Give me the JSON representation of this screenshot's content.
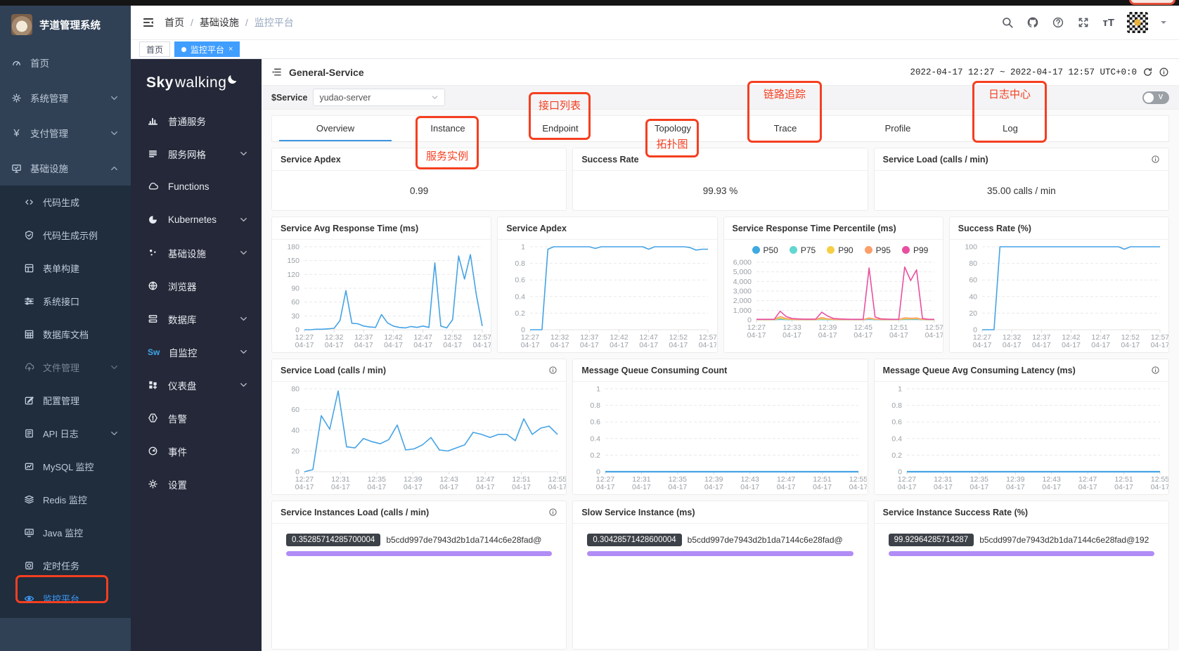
{
  "sidebar": {
    "brand": "芋道管理系统",
    "top": [
      {
        "label": "首页"
      },
      {
        "label": "系统管理",
        "chevron": "down"
      },
      {
        "label": "支付管理",
        "chevron": "down"
      },
      {
        "label": "基础设施",
        "chevron": "up"
      }
    ],
    "sub": [
      {
        "label": "代码生成"
      },
      {
        "label": "代码生成示例"
      },
      {
        "label": "表单构建"
      },
      {
        "label": "系统接口"
      },
      {
        "label": "数据库文档"
      },
      {
        "label": "文件管理",
        "chevron": "down"
      },
      {
        "label": "配置管理"
      },
      {
        "label": "API 日志",
        "chevron": "down"
      },
      {
        "label": "MySQL 监控"
      },
      {
        "label": "Redis 监控"
      },
      {
        "label": "Java 监控"
      },
      {
        "label": "定时任务"
      },
      {
        "label": "监控平台",
        "active": true
      }
    ]
  },
  "topbar": {
    "breadcrumb": [
      "首页",
      "基础设施",
      "监控平台"
    ],
    "icons": [
      "search",
      "github",
      "help",
      "fullscreen",
      "font-size",
      "avatar",
      "caret"
    ]
  },
  "tags": {
    "items": [
      {
        "label": "首页",
        "active": false
      },
      {
        "label": "监控平台",
        "active": true,
        "close": "×"
      }
    ]
  },
  "sw_sidebar": {
    "logo_sky": "Sky",
    "logo_walking": "walking",
    "items": [
      {
        "label": "普通服务"
      },
      {
        "label": "服务网格",
        "chevron": true
      },
      {
        "label": "Functions"
      },
      {
        "label": "Kubernetes",
        "chevron": true
      },
      {
        "label": "基础设施",
        "chevron": true
      },
      {
        "label": "浏览器"
      },
      {
        "label": "数据库",
        "chevron": true
      },
      {
        "label": "自监控",
        "chevron": true,
        "icon_text": "Sw"
      },
      {
        "label": "仪表盘",
        "chevron": true
      },
      {
        "label": "告警"
      },
      {
        "label": "事件"
      },
      {
        "label": "设置"
      }
    ]
  },
  "page_header": {
    "title": "General-Service",
    "time_range": "2022-04-17 12:27 ~ 2022-04-17 12:57 UTC+0:0"
  },
  "service_bar": {
    "label": "$Service",
    "value": "yudao-server",
    "toggle_label": "V"
  },
  "tabs": {
    "items": [
      {
        "label": "Overview",
        "active": true
      },
      {
        "label": "Instance"
      },
      {
        "label": "Endpoint"
      },
      {
        "label": "Topology"
      },
      {
        "label": "Trace"
      },
      {
        "label": "Profile"
      },
      {
        "label": "Log"
      }
    ]
  },
  "annotations": {
    "color": "#f53f20",
    "instance_label": "服务实例",
    "endpoint_label": "接口列表",
    "topology_label": "拓扑图",
    "trace_label": "链路追踪",
    "log_label": "日志中心"
  },
  "metric_cards": [
    {
      "title": "Service Apdex",
      "value": "0.99"
    },
    {
      "title": "Success Rate",
      "value": "99.93 %"
    },
    {
      "title": "Service Load (calls / min)",
      "value": "35.00 calls / min",
      "info": true
    }
  ],
  "chart_data": [
    {
      "id": "avg-rt",
      "type": "line",
      "title": "Service Avg Response Time (ms)",
      "ylim": [
        0,
        180
      ],
      "yticks": [
        0,
        30,
        60,
        90,
        120,
        150,
        180
      ],
      "xlabels": [
        "12:27",
        "12:32",
        "12:37",
        "12:42",
        "12:47",
        "12:52",
        "12:57"
      ],
      "xsub": "04-17",
      "series": [
        {
          "name": "avg-response-time",
          "color": "#45a3e5",
          "values": [
            0,
            0,
            1,
            1,
            2,
            3,
            20,
            85,
            14,
            13,
            8,
            6,
            5,
            33,
            15,
            8,
            5,
            4,
            7,
            5,
            8,
            5,
            145,
            8,
            4,
            22,
            160,
            110,
            163,
            75,
            8
          ]
        }
      ]
    },
    {
      "id": "apdex",
      "type": "line",
      "title": "Service Apdex",
      "ylim": [
        0,
        1
      ],
      "yticks": [
        0,
        0.2,
        0.4,
        0.6,
        0.8,
        1
      ],
      "xlabels": [
        "12:27",
        "12:32",
        "12:37",
        "12:42",
        "12:47",
        "12:52",
        "12:57"
      ],
      "xsub": "04-17",
      "series": [
        {
          "name": "apdex",
          "color": "#45a3e5",
          "values": [
            0,
            0,
            0,
            0.97,
            1,
            1,
            1,
            1,
            1,
            1,
            1,
            0.98,
            1,
            1,
            1,
            1,
            1,
            1,
            1,
            1,
            0.97,
            1,
            1,
            1,
            1,
            1,
            1,
            0.99,
            0.96,
            0.97,
            0.97
          ]
        }
      ]
    },
    {
      "id": "percentile",
      "type": "line",
      "title": "Service Response Time Percentile (ms)",
      "legend": [
        "P50",
        "P75",
        "P90",
        "P95",
        "P99"
      ],
      "ylim": [
        0,
        6000
      ],
      "yticks": [
        0,
        1000,
        2000,
        3000,
        4000,
        5000,
        6000
      ],
      "xlabels": [
        "12:27",
        "12:33",
        "12:39",
        "12:45",
        "12:51",
        "12:57"
      ],
      "xsub": "04-17",
      "series": [
        {
          "name": "P50",
          "color": "#3fa9e0",
          "values": [
            15,
            15,
            15,
            15,
            60,
            30,
            15,
            15,
            15,
            15,
            15,
            50,
            25,
            15,
            15,
            15,
            15,
            15,
            15,
            60,
            20,
            15,
            15,
            15,
            15,
            60,
            50,
            55,
            20,
            15,
            15
          ]
        },
        {
          "name": "P75",
          "color": "#62d6cf",
          "values": [
            25,
            25,
            25,
            25,
            110,
            50,
            25,
            25,
            25,
            25,
            25,
            90,
            45,
            25,
            25,
            25,
            25,
            25,
            25,
            110,
            40,
            25,
            25,
            25,
            25,
            110,
            90,
            100,
            35,
            25,
            25
          ]
        },
        {
          "name": "P90",
          "color": "#f6cf45",
          "values": [
            30,
            30,
            30,
            30,
            180,
            80,
            35,
            30,
            30,
            30,
            30,
            120,
            60,
            35,
            30,
            30,
            30,
            30,
            30,
            150,
            60,
            35,
            30,
            30,
            30,
            120,
            100,
            130,
            45,
            30,
            30
          ]
        },
        {
          "name": "P95",
          "color": "#fb9e69",
          "values": [
            40,
            40,
            40,
            40,
            350,
            150,
            60,
            40,
            40,
            40,
            40,
            250,
            120,
            60,
            40,
            40,
            40,
            40,
            40,
            200,
            80,
            45,
            40,
            40,
            40,
            220,
            170,
            200,
            60,
            40,
            40
          ]
        },
        {
          "name": "P99",
          "color": "#e8509f",
          "values": [
            60,
            60,
            60,
            60,
            900,
            350,
            150,
            100,
            80,
            80,
            80,
            800,
            400,
            150,
            100,
            80,
            60,
            60,
            60,
            5400,
            300,
            100,
            80,
            60,
            60,
            5500,
            4100,
            5200,
            150,
            60,
            60
          ]
        }
      ]
    },
    {
      "id": "success-rate",
      "type": "line",
      "title": "Success Rate (%)",
      "ylim": [
        0,
        100
      ],
      "yticks": [
        0,
        20,
        40,
        60,
        80,
        100
      ],
      "xlabels": [
        "12:27",
        "12:32",
        "12:37",
        "12:42",
        "12:47",
        "12:52",
        "12:57"
      ],
      "xsub": "04-17",
      "series": [
        {
          "name": "success-rate",
          "color": "#45a3e5",
          "values": [
            0,
            0,
            0,
            100,
            100,
            100,
            100,
            100,
            100,
            100,
            100,
            100,
            100,
            100,
            100,
            100,
            100,
            100,
            100,
            100,
            100,
            100,
            100,
            100,
            97,
            100,
            100,
            100,
            100,
            100,
            100
          ]
        }
      ]
    },
    {
      "id": "service-load",
      "type": "line",
      "title": "Service Load (calls / min)",
      "info": true,
      "ylim": [
        0,
        80
      ],
      "yticks": [
        0,
        20,
        40,
        60,
        80
      ],
      "xlabels": [
        "12:27",
        "12:31",
        "12:35",
        "12:39",
        "12:43",
        "12:47",
        "12:51",
        "12:55"
      ],
      "xsub": "04-17",
      "series": [
        {
          "name": "service-load",
          "color": "#45a3e5",
          "values": [
            0,
            2,
            54,
            41,
            78,
            24,
            23,
            32,
            29,
            27,
            31,
            45,
            21,
            22,
            26,
            33,
            21,
            20,
            23,
            26,
            38,
            36,
            33,
            36,
            36,
            30,
            51,
            36,
            42,
            44,
            36
          ]
        }
      ]
    },
    {
      "id": "mq-count",
      "type": "line",
      "title": "Message Queue Consuming Count",
      "ylim": [
        0,
        1
      ],
      "yticks": [
        0,
        0.2,
        0.4,
        0.6,
        0.8,
        1
      ],
      "xlabels": [
        "12:27",
        "12:31",
        "12:35",
        "12:39",
        "12:43",
        "12:47",
        "12:51",
        "12:55"
      ],
      "xsub": "04-17",
      "series": [
        {
          "name": "mq-count",
          "color": "#45a3e5",
          "values": [
            0,
            0
          ]
        }
      ]
    },
    {
      "id": "mq-latency",
      "type": "line",
      "title": "Message Queue Avg Consuming Latency (ms)",
      "info": true,
      "ylim": [
        0,
        1
      ],
      "yticks": [
        0,
        0.2,
        0.4,
        0.6,
        0.8,
        1
      ],
      "xlabels": [
        "12:27",
        "12:31",
        "12:35",
        "12:39",
        "12:43",
        "12:47",
        "12:51",
        "12:55"
      ],
      "xsub": "04-17",
      "series": [
        {
          "name": "mq-latency",
          "color": "#45a3e5",
          "values": [
            0,
            0
          ]
        }
      ]
    }
  ],
  "instance_cards": [
    {
      "title": "Service Instances Load (calls / min)",
      "info": true,
      "badge": "0.35285714285700004",
      "instance": "b5cdd997de7943d2b1da7144c6e28fad@"
    },
    {
      "title": "Slow Service Instance (ms)",
      "badge": "0.30428571428600004",
      "instance": "b5cdd997de7943d2b1da7144c6e28fad@"
    },
    {
      "title": "Service Instance Success Rate (%)",
      "badge": "99.92964285714287",
      "instance": "b5cdd997de7943d2b1da7144c6e28fad@192"
    }
  ]
}
